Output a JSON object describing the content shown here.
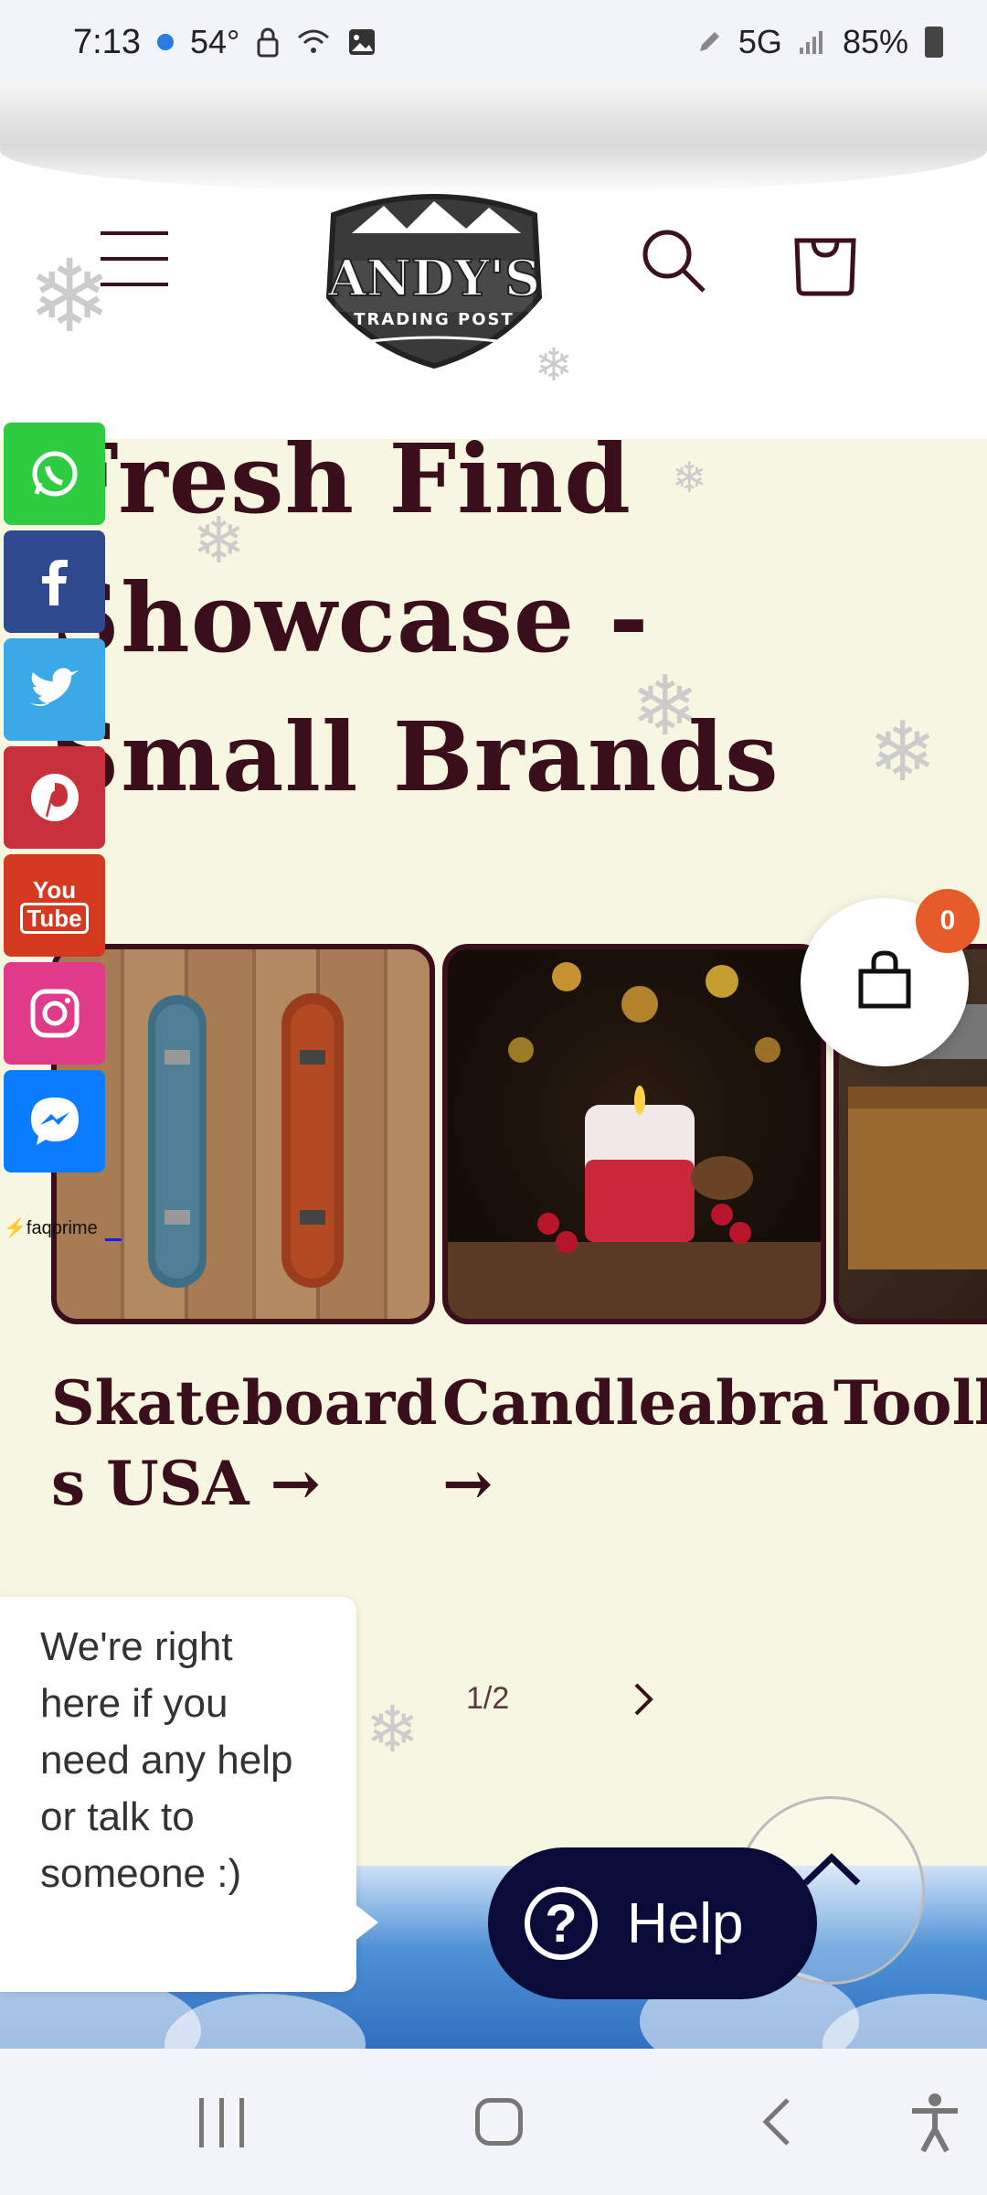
{
  "status_bar": {
    "time": "7:13",
    "temperature": "54°",
    "network": "5G",
    "battery": "85%"
  },
  "header": {
    "menu_icon": "hamburger-menu-icon",
    "logo_name": "ANDY'S",
    "logo_tagline": "TRADING POST",
    "search_icon": "search-icon",
    "cart_icon": "bag-icon"
  },
  "hero": {
    "title_line1": "Fresh Find",
    "title_line2": "Showcase -",
    "title_line3": "Small Brands"
  },
  "social": [
    "whatsapp",
    "facebook",
    "twitter",
    "pinterest",
    "youtube",
    "instagram",
    "messenger"
  ],
  "social_colors": {
    "whatsapp": "#2ecc40",
    "facebook": "#2f4a8f",
    "twitter": "#3aa9e6",
    "pinterest": "#c8303b",
    "youtube": "#d43a1f",
    "instagram": "#e03a8a",
    "messenger": "#0a7cff"
  },
  "faq_badge": "faqprime",
  "collections": [
    {
      "title_line1": "Skateboard",
      "title_line2": "s USA →"
    },
    {
      "title_line1": "Candleabra",
      "title_line2": "→"
    },
    {
      "title_line1": "Toolb",
      "title_line2": ""
    }
  ],
  "floating_cart": {
    "count": "0"
  },
  "pager": {
    "text": "1/2"
  },
  "chat": {
    "message": "We're right here if you need any help or talk to someone :)"
  },
  "help_button": {
    "label": "Help"
  },
  "colors": {
    "accent": "#3a0e1a",
    "background": "#f7f7e1",
    "badge": "#e65b2a",
    "help_bg": "#0b0b3a"
  }
}
